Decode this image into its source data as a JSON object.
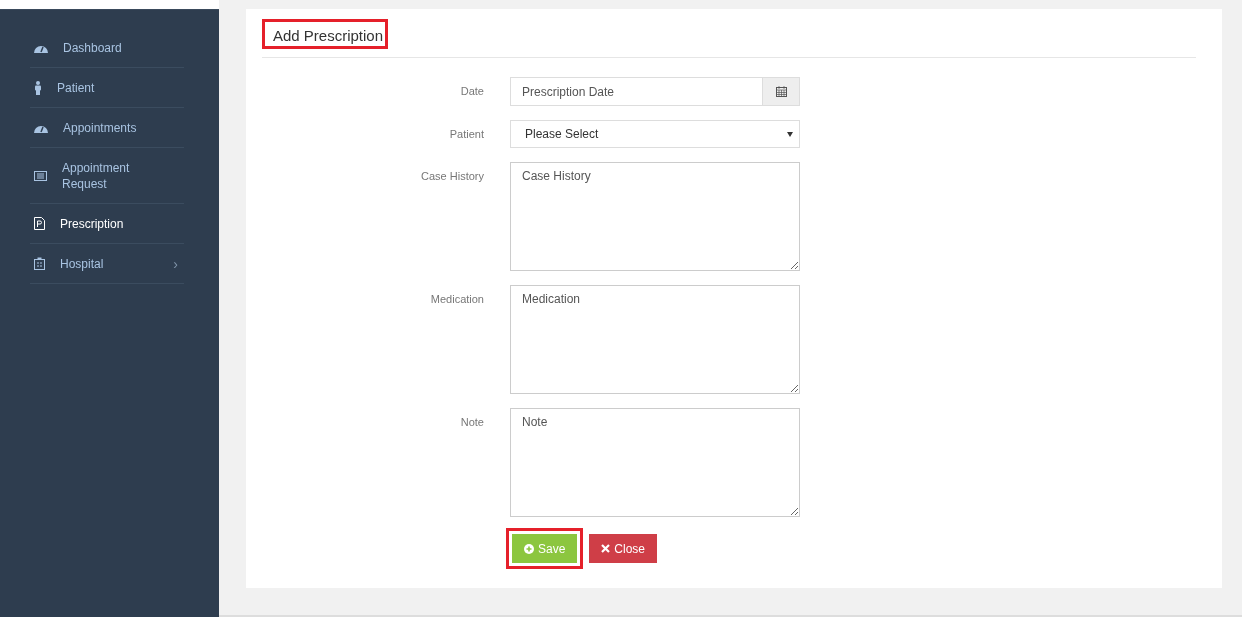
{
  "sidebar": {
    "items": [
      {
        "label": "Dashboard",
        "kind": "gauge",
        "selected": false
      },
      {
        "label": "Patient",
        "kind": "person",
        "selected": false
      },
      {
        "label": "Appointments",
        "kind": "gauge",
        "selected": false
      },
      {
        "label": "Appointment Request",
        "kind": "list",
        "selected": false
      },
      {
        "label": "Prescription",
        "kind": "file",
        "selected": true
      },
      {
        "label": "Hospital",
        "kind": "hospital",
        "selected": false,
        "chevron": "›"
      }
    ]
  },
  "form": {
    "title": "Add Prescription",
    "title_highlighted": true,
    "fields": [
      {
        "kind": "date",
        "label": "Date",
        "placeholder": "Prescription Date"
      },
      {
        "kind": "select",
        "label": "Patient",
        "value": "Please Select"
      },
      {
        "kind": "textarea",
        "label": "Case History",
        "placeholder": "Case History"
      },
      {
        "kind": "textarea",
        "label": "Medication",
        "placeholder": "Medication"
      },
      {
        "kind": "textarea",
        "label": "Note",
        "placeholder": "Note"
      }
    ],
    "buttons": [
      {
        "kind": "save",
        "label": "Save",
        "highlighted": true
      },
      {
        "kind": "close",
        "label": "Close",
        "highlighted": false
      }
    ]
  }
}
